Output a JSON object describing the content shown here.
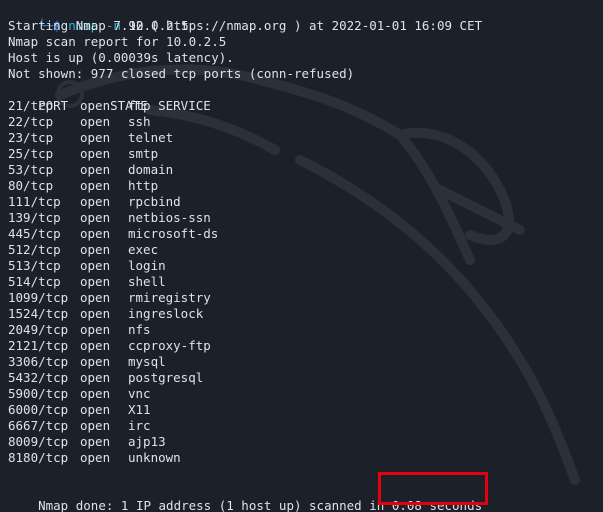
{
  "prompt": {
    "tree": "└─",
    "dollar": "$",
    "command": "nmap",
    "flag": "-n",
    "target": "10.0.2.5"
  },
  "header_lines": [
    "Starting Nmap 7.92 ( https://nmap.org ) at 2022-01-01 16:09 CET",
    "Nmap scan report for 10.0.2.5",
    "Host is up (0.00039s latency).",
    "Not shown: 977 closed tcp ports (conn-refused)"
  ],
  "table": {
    "headers": [
      "PORT",
      "STATE",
      "SERVICE"
    ],
    "rows": [
      [
        "21/tcp",
        "open",
        "ftp"
      ],
      [
        "22/tcp",
        "open",
        "ssh"
      ],
      [
        "23/tcp",
        "open",
        "telnet"
      ],
      [
        "25/tcp",
        "open",
        "smtp"
      ],
      [
        "53/tcp",
        "open",
        "domain"
      ],
      [
        "80/tcp",
        "open",
        "http"
      ],
      [
        "111/tcp",
        "open",
        "rpcbind"
      ],
      [
        "139/tcp",
        "open",
        "netbios-ssn"
      ],
      [
        "445/tcp",
        "open",
        "microsoft-ds"
      ],
      [
        "512/tcp",
        "open",
        "exec"
      ],
      [
        "513/tcp",
        "open",
        "login"
      ],
      [
        "514/tcp",
        "open",
        "shell"
      ],
      [
        "1099/tcp",
        "open",
        "rmiregistry"
      ],
      [
        "1524/tcp",
        "open",
        "ingreslock"
      ],
      [
        "2049/tcp",
        "open",
        "nfs"
      ],
      [
        "2121/tcp",
        "open",
        "ccproxy-ftp"
      ],
      [
        "3306/tcp",
        "open",
        "mysql"
      ],
      [
        "5432/tcp",
        "open",
        "postgresql"
      ],
      [
        "5900/tcp",
        "open",
        "vnc"
      ],
      [
        "6000/tcp",
        "open",
        "X11"
      ],
      [
        "6667/tcp",
        "open",
        "irc"
      ],
      [
        "8009/tcp",
        "open",
        "ajp13"
      ],
      [
        "8180/tcp",
        "open",
        "unknown"
      ]
    ]
  },
  "footer": {
    "prefix": "Nmap done: 1 IP address (1 host up) scanned in ",
    "duration": "0.08 seconds"
  },
  "colors": {
    "background": "#1c2028",
    "text": "#dfe3e8",
    "prompt_blue": "#3a7bd5",
    "command_cyan": "#2fb8d6",
    "highlight_red": "#e3000f"
  },
  "icons": {
    "background_watermark": "kali-dragon-icon"
  }
}
